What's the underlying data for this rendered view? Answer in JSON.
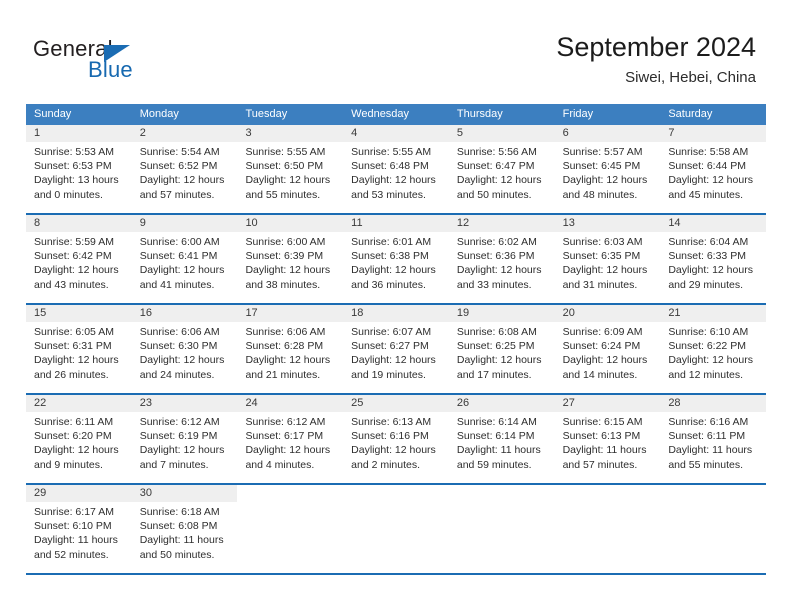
{
  "brand": {
    "line1": "General",
    "line2": "Blue",
    "logo_icon": "triangle-icon",
    "accent_color": "#1b6cb3"
  },
  "header": {
    "title": "September 2024",
    "subtitle": "Siwei, Hebei, China"
  },
  "calendar": {
    "header_bg": "#3c7fc0",
    "row_divider": "#1b6cb3",
    "daynum_band": "#efefef",
    "weekdays": [
      "Sunday",
      "Monday",
      "Tuesday",
      "Wednesday",
      "Thursday",
      "Friday",
      "Saturday"
    ],
    "weeks": [
      [
        {
          "day": "1",
          "sunrise": "Sunrise: 5:53 AM",
          "sunset": "Sunset: 6:53 PM",
          "daylight1": "Daylight: 13 hours",
          "daylight2": "and 0 minutes."
        },
        {
          "day": "2",
          "sunrise": "Sunrise: 5:54 AM",
          "sunset": "Sunset: 6:52 PM",
          "daylight1": "Daylight: 12 hours",
          "daylight2": "and 57 minutes."
        },
        {
          "day": "3",
          "sunrise": "Sunrise: 5:55 AM",
          "sunset": "Sunset: 6:50 PM",
          "daylight1": "Daylight: 12 hours",
          "daylight2": "and 55 minutes."
        },
        {
          "day": "4",
          "sunrise": "Sunrise: 5:55 AM",
          "sunset": "Sunset: 6:48 PM",
          "daylight1": "Daylight: 12 hours",
          "daylight2": "and 53 minutes."
        },
        {
          "day": "5",
          "sunrise": "Sunrise: 5:56 AM",
          "sunset": "Sunset: 6:47 PM",
          "daylight1": "Daylight: 12 hours",
          "daylight2": "and 50 minutes."
        },
        {
          "day": "6",
          "sunrise": "Sunrise: 5:57 AM",
          "sunset": "Sunset: 6:45 PM",
          "daylight1": "Daylight: 12 hours",
          "daylight2": "and 48 minutes."
        },
        {
          "day": "7",
          "sunrise": "Sunrise: 5:58 AM",
          "sunset": "Sunset: 6:44 PM",
          "daylight1": "Daylight: 12 hours",
          "daylight2": "and 45 minutes."
        }
      ],
      [
        {
          "day": "8",
          "sunrise": "Sunrise: 5:59 AM",
          "sunset": "Sunset: 6:42 PM",
          "daylight1": "Daylight: 12 hours",
          "daylight2": "and 43 minutes."
        },
        {
          "day": "9",
          "sunrise": "Sunrise: 6:00 AM",
          "sunset": "Sunset: 6:41 PM",
          "daylight1": "Daylight: 12 hours",
          "daylight2": "and 41 minutes."
        },
        {
          "day": "10",
          "sunrise": "Sunrise: 6:00 AM",
          "sunset": "Sunset: 6:39 PM",
          "daylight1": "Daylight: 12 hours",
          "daylight2": "and 38 minutes."
        },
        {
          "day": "11",
          "sunrise": "Sunrise: 6:01 AM",
          "sunset": "Sunset: 6:38 PM",
          "daylight1": "Daylight: 12 hours",
          "daylight2": "and 36 minutes."
        },
        {
          "day": "12",
          "sunrise": "Sunrise: 6:02 AM",
          "sunset": "Sunset: 6:36 PM",
          "daylight1": "Daylight: 12 hours",
          "daylight2": "and 33 minutes."
        },
        {
          "day": "13",
          "sunrise": "Sunrise: 6:03 AM",
          "sunset": "Sunset: 6:35 PM",
          "daylight1": "Daylight: 12 hours",
          "daylight2": "and 31 minutes."
        },
        {
          "day": "14",
          "sunrise": "Sunrise: 6:04 AM",
          "sunset": "Sunset: 6:33 PM",
          "daylight1": "Daylight: 12 hours",
          "daylight2": "and 29 minutes."
        }
      ],
      [
        {
          "day": "15",
          "sunrise": "Sunrise: 6:05 AM",
          "sunset": "Sunset: 6:31 PM",
          "daylight1": "Daylight: 12 hours",
          "daylight2": "and 26 minutes."
        },
        {
          "day": "16",
          "sunrise": "Sunrise: 6:06 AM",
          "sunset": "Sunset: 6:30 PM",
          "daylight1": "Daylight: 12 hours",
          "daylight2": "and 24 minutes."
        },
        {
          "day": "17",
          "sunrise": "Sunrise: 6:06 AM",
          "sunset": "Sunset: 6:28 PM",
          "daylight1": "Daylight: 12 hours",
          "daylight2": "and 21 minutes."
        },
        {
          "day": "18",
          "sunrise": "Sunrise: 6:07 AM",
          "sunset": "Sunset: 6:27 PM",
          "daylight1": "Daylight: 12 hours",
          "daylight2": "and 19 minutes."
        },
        {
          "day": "19",
          "sunrise": "Sunrise: 6:08 AM",
          "sunset": "Sunset: 6:25 PM",
          "daylight1": "Daylight: 12 hours",
          "daylight2": "and 17 minutes."
        },
        {
          "day": "20",
          "sunrise": "Sunrise: 6:09 AM",
          "sunset": "Sunset: 6:24 PM",
          "daylight1": "Daylight: 12 hours",
          "daylight2": "and 14 minutes."
        },
        {
          "day": "21",
          "sunrise": "Sunrise: 6:10 AM",
          "sunset": "Sunset: 6:22 PM",
          "daylight1": "Daylight: 12 hours",
          "daylight2": "and 12 minutes."
        }
      ],
      [
        {
          "day": "22",
          "sunrise": "Sunrise: 6:11 AM",
          "sunset": "Sunset: 6:20 PM",
          "daylight1": "Daylight: 12 hours",
          "daylight2": "and 9 minutes."
        },
        {
          "day": "23",
          "sunrise": "Sunrise: 6:12 AM",
          "sunset": "Sunset: 6:19 PM",
          "daylight1": "Daylight: 12 hours",
          "daylight2": "and 7 minutes."
        },
        {
          "day": "24",
          "sunrise": "Sunrise: 6:12 AM",
          "sunset": "Sunset: 6:17 PM",
          "daylight1": "Daylight: 12 hours",
          "daylight2": "and 4 minutes."
        },
        {
          "day": "25",
          "sunrise": "Sunrise: 6:13 AM",
          "sunset": "Sunset: 6:16 PM",
          "daylight1": "Daylight: 12 hours",
          "daylight2": "and 2 minutes."
        },
        {
          "day": "26",
          "sunrise": "Sunrise: 6:14 AM",
          "sunset": "Sunset: 6:14 PM",
          "daylight1": "Daylight: 11 hours",
          "daylight2": "and 59 minutes."
        },
        {
          "day": "27",
          "sunrise": "Sunrise: 6:15 AM",
          "sunset": "Sunset: 6:13 PM",
          "daylight1": "Daylight: 11 hours",
          "daylight2": "and 57 minutes."
        },
        {
          "day": "28",
          "sunrise": "Sunrise: 6:16 AM",
          "sunset": "Sunset: 6:11 PM",
          "daylight1": "Daylight: 11 hours",
          "daylight2": "and 55 minutes."
        }
      ],
      [
        {
          "day": "29",
          "sunrise": "Sunrise: 6:17 AM",
          "sunset": "Sunset: 6:10 PM",
          "daylight1": "Daylight: 11 hours",
          "daylight2": "and 52 minutes."
        },
        {
          "day": "30",
          "sunrise": "Sunrise: 6:18 AM",
          "sunset": "Sunset: 6:08 PM",
          "daylight1": "Daylight: 11 hours",
          "daylight2": "and 50 minutes."
        },
        {
          "day": "",
          "sunrise": "",
          "sunset": "",
          "daylight1": "",
          "daylight2": ""
        },
        {
          "day": "",
          "sunrise": "",
          "sunset": "",
          "daylight1": "",
          "daylight2": ""
        },
        {
          "day": "",
          "sunrise": "",
          "sunset": "",
          "daylight1": "",
          "daylight2": ""
        },
        {
          "day": "",
          "sunrise": "",
          "sunset": "",
          "daylight1": "",
          "daylight2": ""
        },
        {
          "day": "",
          "sunrise": "",
          "sunset": "",
          "daylight1": "",
          "daylight2": ""
        }
      ]
    ]
  }
}
